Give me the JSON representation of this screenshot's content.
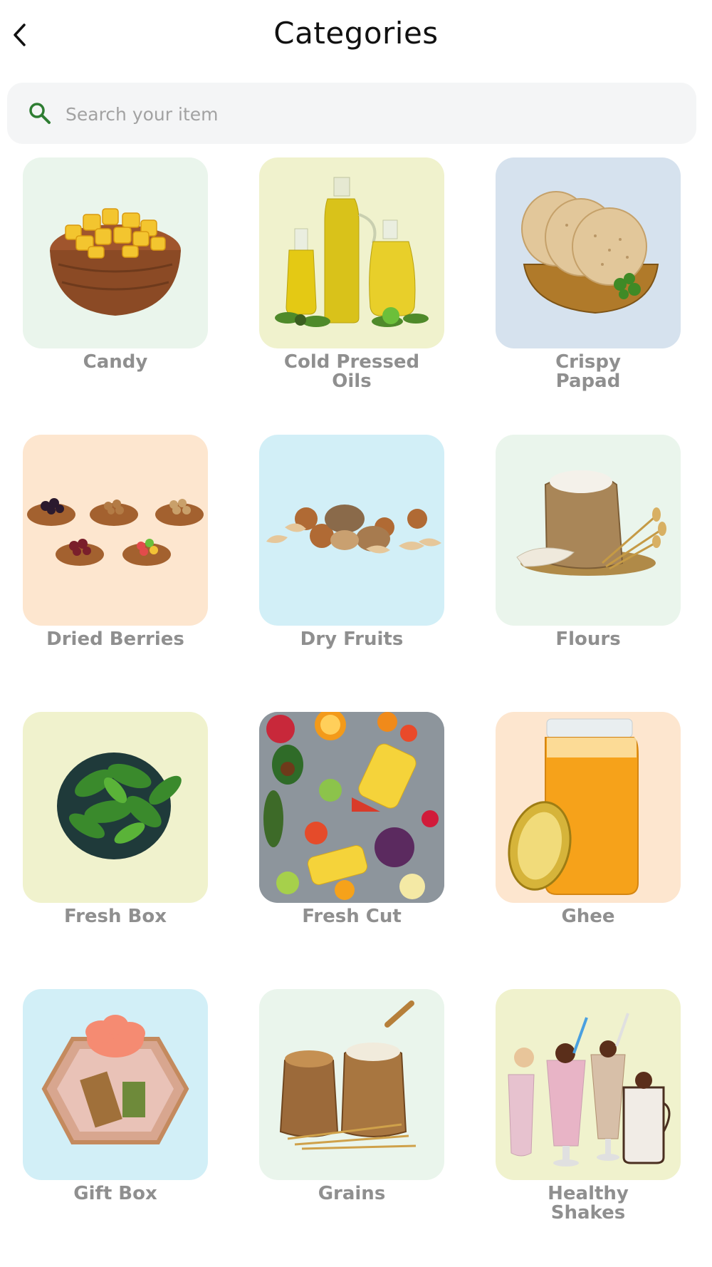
{
  "header": {
    "title": "Categories",
    "back_icon": "chevron-left-icon"
  },
  "search": {
    "placeholder": "Search your item",
    "value": "",
    "icon": "search-icon",
    "icon_color": "#2e7d32"
  },
  "categories": [
    {
      "label": "Candy",
      "bg": "#eaf5ec"
    },
    {
      "label": "Cold Pressed\nOils",
      "bg": "#f0f2cd"
    },
    {
      "label": "Crispy\nPapad",
      "bg": "#d6e2ee"
    },
    {
      "label": "Dried Berries",
      "bg": "#fde6cf"
    },
    {
      "label": "Dry Fruits",
      "bg": "#d2eff7"
    },
    {
      "label": "Flours",
      "bg": "#eaf5ec"
    },
    {
      "label": "Fresh Box",
      "bg": "#f0f2cd"
    },
    {
      "label": "Fresh Cut",
      "bg": "#9aa3ab"
    },
    {
      "label": "Ghee",
      "bg": "#fde6cf"
    },
    {
      "label": "Gift Box",
      "bg": "#d2eff7"
    },
    {
      "label": "Grains",
      "bg": "#eaf5ec"
    },
    {
      "label": "Healthy\nShakes",
      "bg": "#f0f2cd"
    }
  ]
}
